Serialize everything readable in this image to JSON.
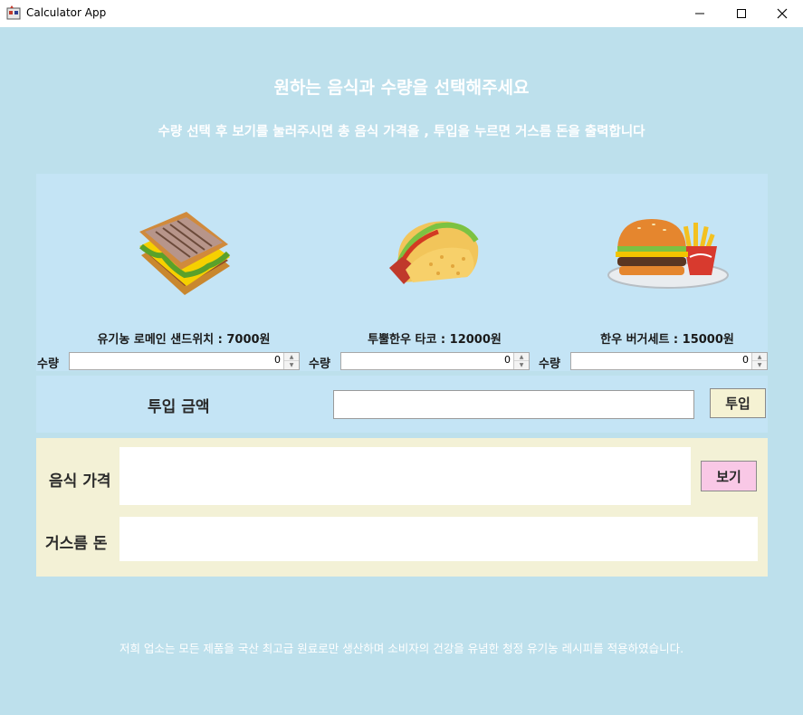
{
  "window": {
    "title": "Calculator App",
    "minimize_icon": "minimize-icon",
    "maximize_icon": "maximize-icon",
    "close_icon": "close-icon"
  },
  "header": {
    "title": "원하는 음식과 수량을 선택해주세요",
    "subtitle": "수량 선택 후 보기를 눌러주시면 총 음식 가격을 , 투입을 누르면 거스름 돈을 출력합니다"
  },
  "menu": {
    "quantity_label": "수량",
    "items": [
      {
        "icon": "sandwich-icon",
        "label": "유기농 로메인 샌드위치 : 7000원",
        "quantity": "0"
      },
      {
        "icon": "taco-icon",
        "label": "투뿔한우 타코 : 12000원",
        "quantity": "0"
      },
      {
        "icon": "burger-set-icon",
        "label": "한우 버거세트 : 15000원",
        "quantity": "0"
      }
    ]
  },
  "payment": {
    "label": "투입 금액",
    "input_value": "",
    "button_label": "투입"
  },
  "results": {
    "food_price_label": "음식 가격",
    "food_price_value": "",
    "view_button_label": "보기",
    "change_label": "거스름 돈",
    "change_value": ""
  },
  "footer": {
    "text": "저희 업소는 모든 제품을 국산 최고급 원료로만 생산하며 소비자의 건강을 유념한 청정 유기농 레시피를 적용하였습니다."
  },
  "colors": {
    "background": "#bde0ec",
    "panel": "#c4e4f5",
    "result_panel": "#f3f1d6",
    "pay_button": "#f5f2d3",
    "view_button": "#f9c8e6"
  }
}
